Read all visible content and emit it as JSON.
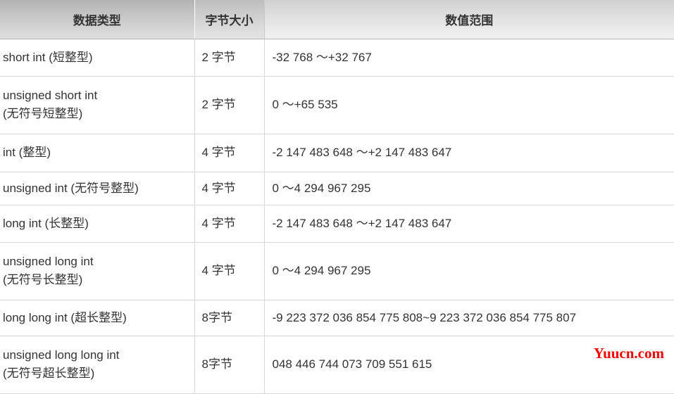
{
  "table": {
    "columns": [
      {
        "key": "type",
        "header": "数据类型"
      },
      {
        "key": "size",
        "header": "字节大小"
      },
      {
        "key": "range",
        "header": "数值范围"
      }
    ],
    "rows": [
      {
        "type": "short int (短整型)",
        "size": "2 字节",
        "range": "-32 768 ～+32 767"
      },
      {
        "type": "unsigned short int\n(无符号短整型)",
        "size": "2 字节",
        "range": "0 ～+65 535"
      },
      {
        "type": "int (整型)",
        "size": "4 字节",
        "range": "-2 147 483 648 ～+2 147 483 647"
      },
      {
        "type": "unsigned int (无符号整型)",
        "size": "4 字节",
        "range": "0 ～4 294 967 295"
      },
      {
        "type": "long int (长整型)",
        "size": "4 字节",
        "range": "-2 147 483 648 ～+2 147 483 647"
      },
      {
        "type": "unsigned long int\n(无符号长整型)",
        "size": "4 字节",
        "range": "0 ～4 294 967 295"
      },
      {
        "type": "long long int (超长整型)",
        "size": "8字节",
        "range": "-9 223 372 036 854 775 808~9 223 372 036 854 775 807"
      },
      {
        "type": "unsigned long long int\n(无符号超长整型)",
        "size": "8字节",
        "range": "048 446 744 073 709 551 615"
      }
    ]
  },
  "watermark": {
    "text": "Yuucn.com",
    "color": "#ff0000"
  },
  "colors": {
    "header_gradient_top": "#b2b2b2",
    "header_gradient_bottom": "#dcdcdc",
    "row_border": "#d7d7d7",
    "text": "#333333",
    "cell_background": "#ffffff"
  }
}
